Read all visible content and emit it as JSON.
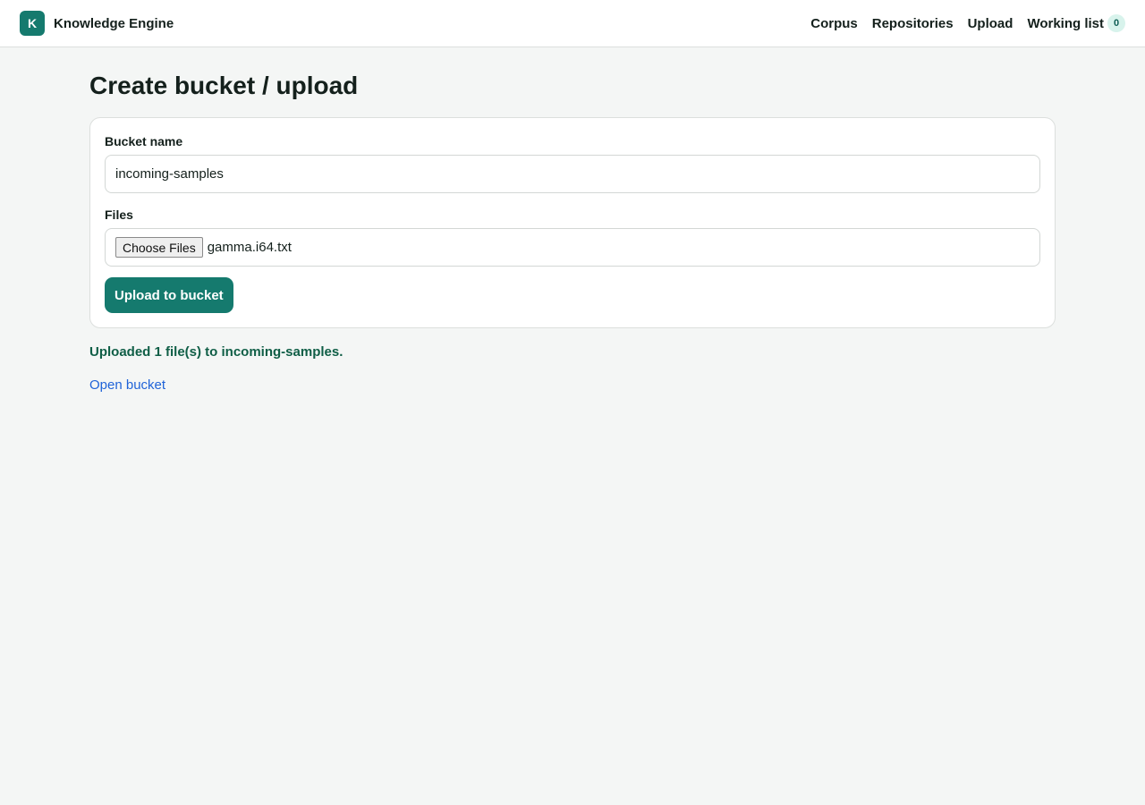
{
  "header": {
    "logo_letter": "K",
    "app_name": "Knowledge Engine",
    "nav": {
      "corpus": "Corpus",
      "repositories": "Repositories",
      "upload": "Upload",
      "working_list": "Working list",
      "working_list_count": "0"
    }
  },
  "page": {
    "title": "Create bucket / upload"
  },
  "form": {
    "bucket_label": "Bucket name",
    "bucket_value": "incoming-samples",
    "files_label": "Files",
    "choose_files_label": "Choose Files",
    "selected_file": "gamma.i64.txt",
    "submit_label": "Upload to bucket"
  },
  "result": {
    "message": "Uploaded 1 file(s) to incoming-samples.",
    "open_link": "Open bucket"
  },
  "colors": {
    "accent": "#157a6e",
    "success_text": "#0f5e46",
    "link": "#1f63d8",
    "background": "#f4f6f5"
  }
}
